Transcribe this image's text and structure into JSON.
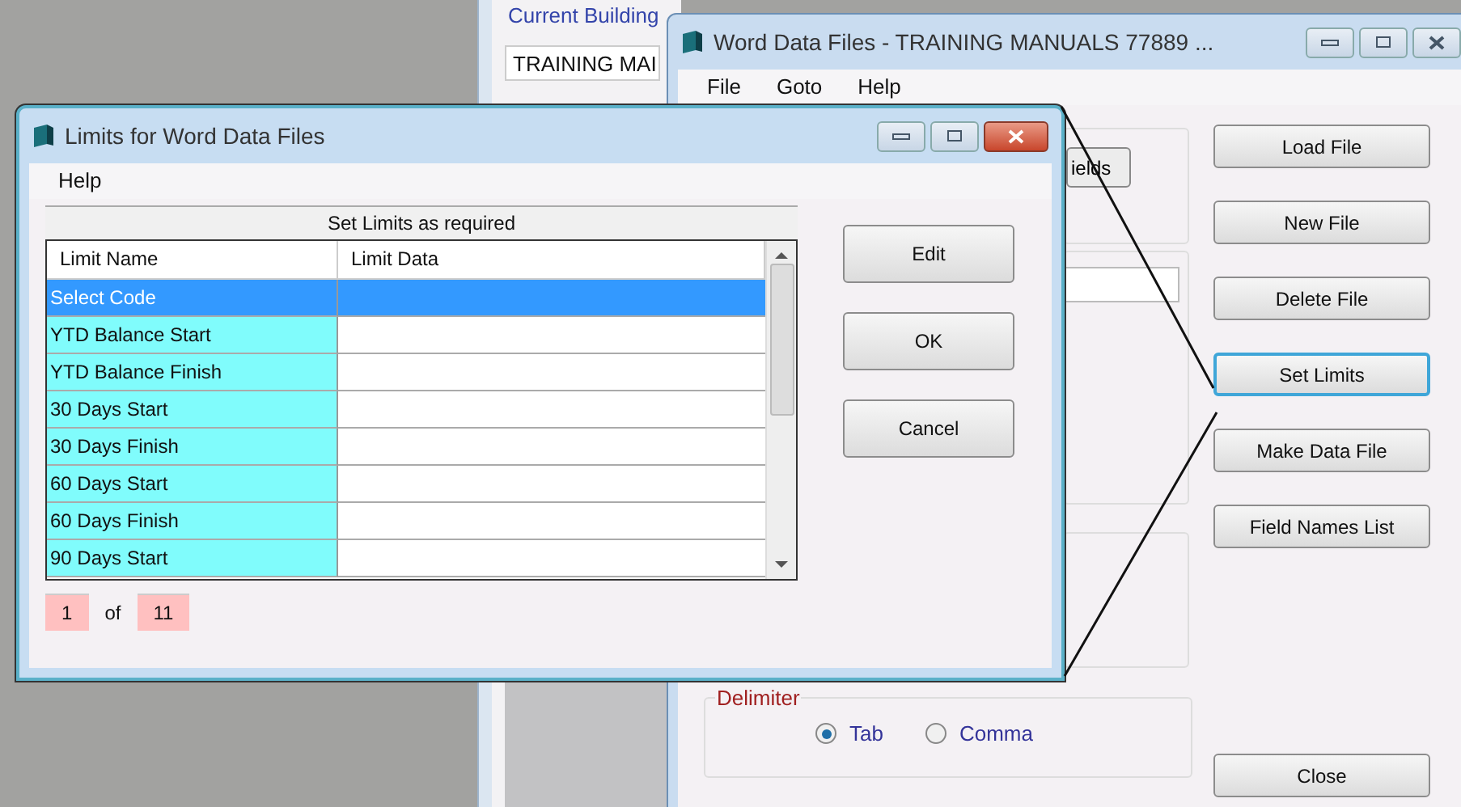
{
  "background_window": {
    "label": "Current Building",
    "field_value": "TRAINING MAI"
  },
  "main_window": {
    "title": "Word Data Files - TRAINING MANUALS 77889 ...",
    "menu": [
      "File",
      "Goto",
      "Help"
    ],
    "partial_button": "ields",
    "buttons": [
      {
        "label": "Load File",
        "focused": false
      },
      {
        "label": "New File",
        "focused": false
      },
      {
        "label": "Delete File",
        "focused": false
      },
      {
        "label": "Set Limits",
        "focused": true
      },
      {
        "label": "Make Data File",
        "focused": false
      },
      {
        "label": "Field Names List",
        "focused": false
      }
    ],
    "delimiter": {
      "label": "Delimiter",
      "options": [
        {
          "label": "Tab",
          "selected": true
        },
        {
          "label": "Comma",
          "selected": false
        }
      ]
    },
    "close_button": "Close"
  },
  "dialog": {
    "title": "Limits for Word Data Files",
    "menu": [
      "Help"
    ],
    "caption": "Set Limits as required",
    "columns": [
      "Limit Name",
      "Limit Data"
    ],
    "rows": [
      {
        "name": "Select Code",
        "selected": true
      },
      {
        "name": "YTD Balance Start",
        "selected": false
      },
      {
        "name": "YTD Balance Finish",
        "selected": false
      },
      {
        "name": "30 Days Start",
        "selected": false
      },
      {
        "name": "30 Days Finish",
        "selected": false
      },
      {
        "name": "60 Days Start",
        "selected": false
      },
      {
        "name": "60 Days Finish",
        "selected": false
      },
      {
        "name": "90 Days Start",
        "selected": false
      }
    ],
    "record": {
      "current": "1",
      "separator": "of",
      "total": "11"
    },
    "buttons": [
      "Edit",
      "OK",
      "Cancel"
    ]
  }
}
